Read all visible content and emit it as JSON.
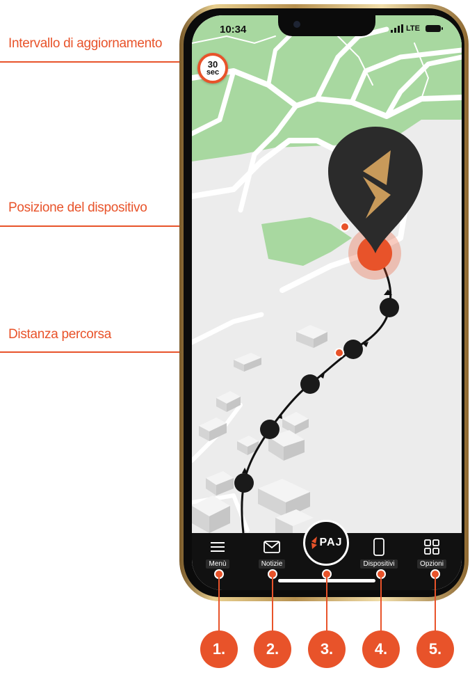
{
  "callouts": {
    "refresh_interval": "Intervallo di aggiornamento",
    "device_position": "Posizione del dispositivo",
    "distance_traveled": "Distanza percorsa"
  },
  "status_bar": {
    "time": "10:34",
    "network": "LTE"
  },
  "refresh_badge": {
    "value": "30",
    "unit": "sec"
  },
  "nav": {
    "items": [
      {
        "label": "Menù",
        "icon": "menu-icon"
      },
      {
        "label": "Notizie",
        "icon": "mail-icon"
      },
      {
        "label": "Dispositivi",
        "icon": "phone-device-icon"
      },
      {
        "label": "Opzioni",
        "icon": "grid-icon"
      }
    ],
    "center_logo_text": "PAJ"
  },
  "numbered_badges": [
    "1.",
    "2.",
    "3.",
    "4.",
    "5."
  ],
  "colors": {
    "accent": "#e8532a",
    "map_green": "#a8d8a0",
    "map_background": "#ececec",
    "nav_background": "#111111",
    "pin_dark": "#2b2b2b",
    "pin_gold": "#c89a5a"
  }
}
